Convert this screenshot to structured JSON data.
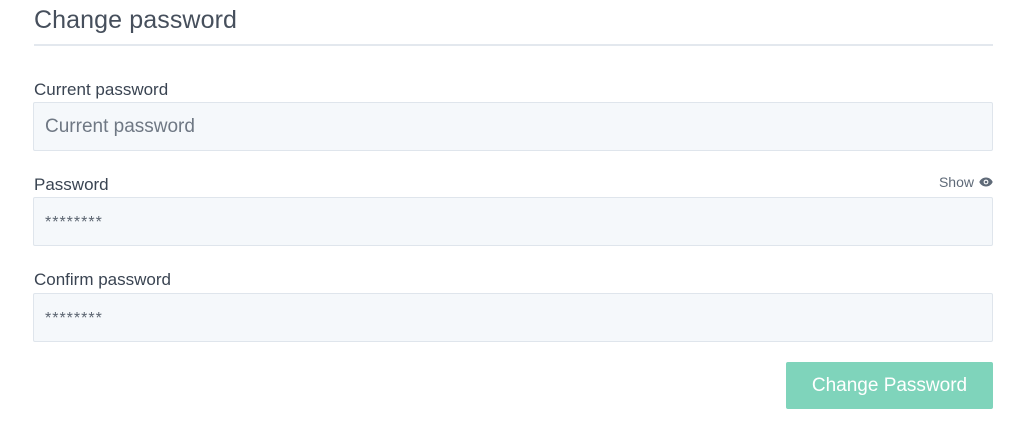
{
  "page": {
    "title": "Change password"
  },
  "form": {
    "current_password": {
      "label": "Current password",
      "placeholder": "Current password",
      "value": ""
    },
    "password": {
      "label": "Password",
      "placeholder": "********",
      "value": "",
      "show_label": "Show",
      "show_icon": "eye-icon"
    },
    "confirm_password": {
      "label": "Confirm password",
      "placeholder": "********",
      "value": ""
    },
    "submit_label": "Change Password"
  },
  "colors": {
    "accent": "#7fd4bb",
    "input_bg": "#f5f8fb",
    "input_border": "#dfe5ec",
    "text": "#3a4452"
  }
}
